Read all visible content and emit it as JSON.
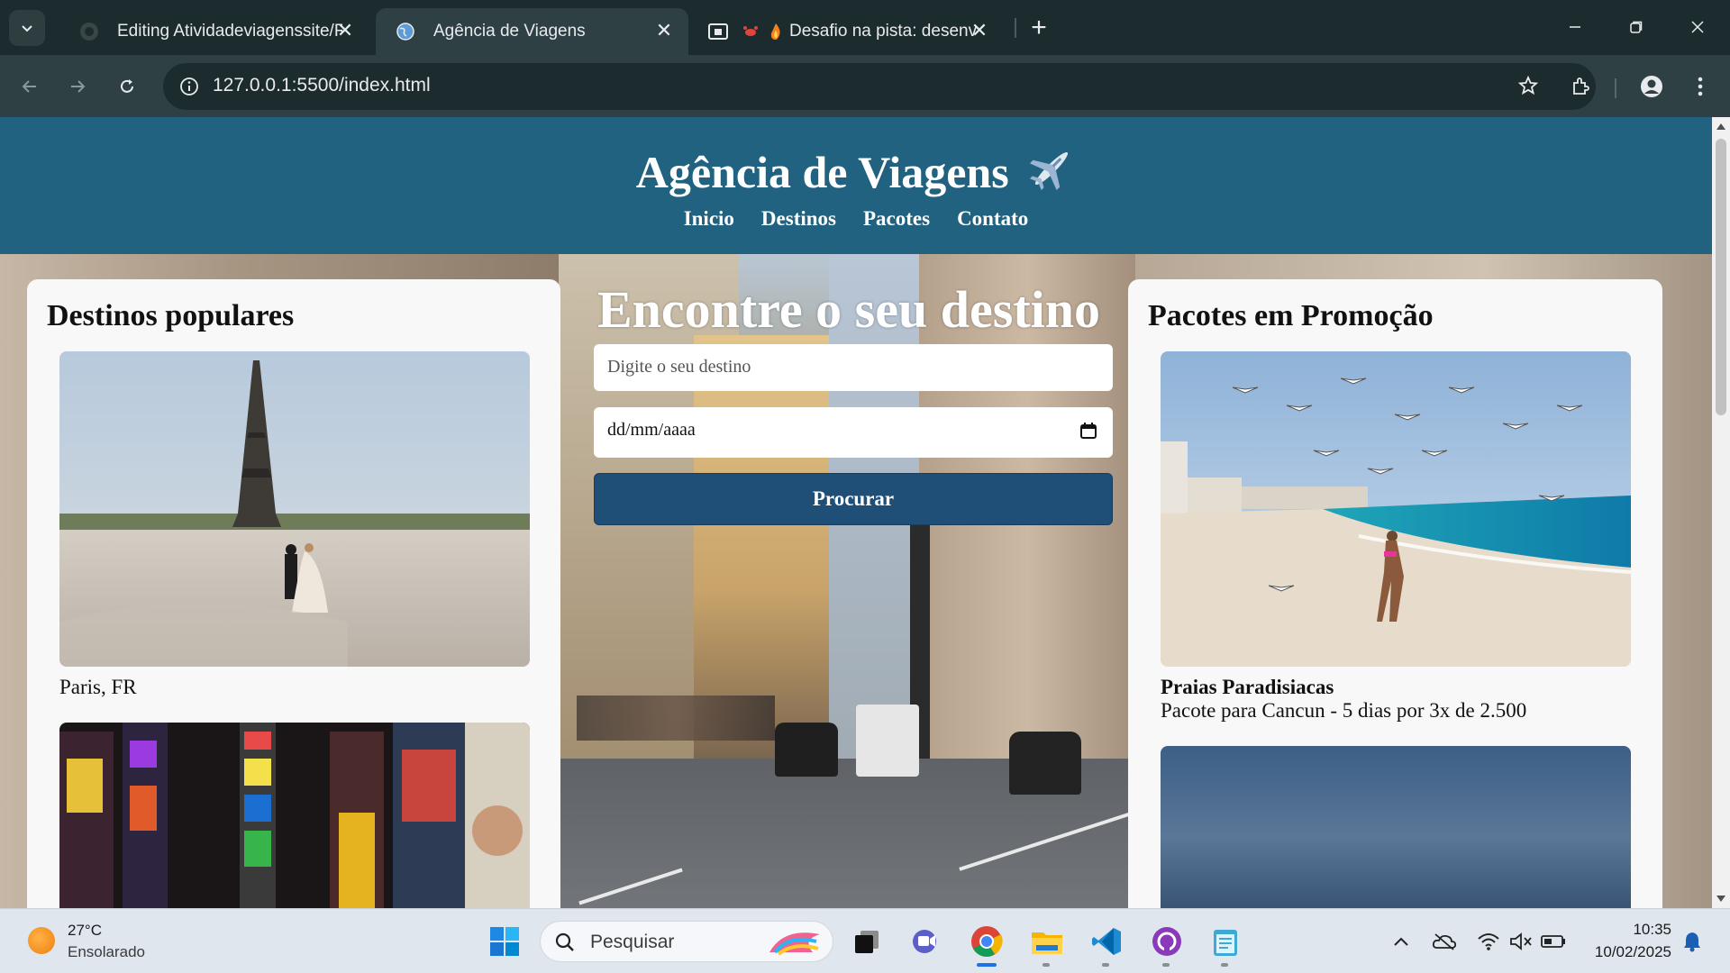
{
  "browser": {
    "tabs": [
      {
        "title": "Editing Atividadeviagenssite/RE",
        "active": false
      },
      {
        "title": "Agência de Viagens",
        "active": true
      },
      {
        "title": "Desafio na pista: desenv",
        "active": false
      }
    ],
    "address_bar": {
      "url": "127.0.0.1:5500/index.html"
    }
  },
  "site": {
    "title": "Agência de Viagens",
    "nav": [
      "Inicio",
      "Destinos",
      "Pacotes",
      "Contato"
    ],
    "search": {
      "heading": "Encontre o seu destino",
      "destination_placeholder": "Digite o seu destino",
      "date_placeholder": "dd/mm/aaaa",
      "button_label": "Procurar"
    },
    "popular": {
      "heading": "Destinos populares",
      "items": [
        {
          "caption": "Paris, FR",
          "image": "eiffel-tower-photo"
        },
        {
          "caption": "",
          "image": "times-square-photo"
        }
      ]
    },
    "packages": {
      "heading": "Pacotes em Promoção",
      "items": [
        {
          "title": "Praias Paradisiacas",
          "description": "Pacote para Cancun - 5 dias por 3x de 2.500",
          "image": "cancun-beach-photo"
        },
        {
          "title": "",
          "description": "",
          "image": "cloudy-sky-photo"
        }
      ]
    }
  },
  "taskbar": {
    "weather": {
      "temp": "27°C",
      "desc": "Ensolarado"
    },
    "search_placeholder": "Pesquisar",
    "clock": {
      "time": "10:35",
      "date": "10/02/2025"
    }
  },
  "colors": {
    "header_bg": "#216280",
    "button_bg": "#1f4f77",
    "chrome_bg": "#1c2b2e",
    "toolbar_bg": "#2e4043"
  }
}
